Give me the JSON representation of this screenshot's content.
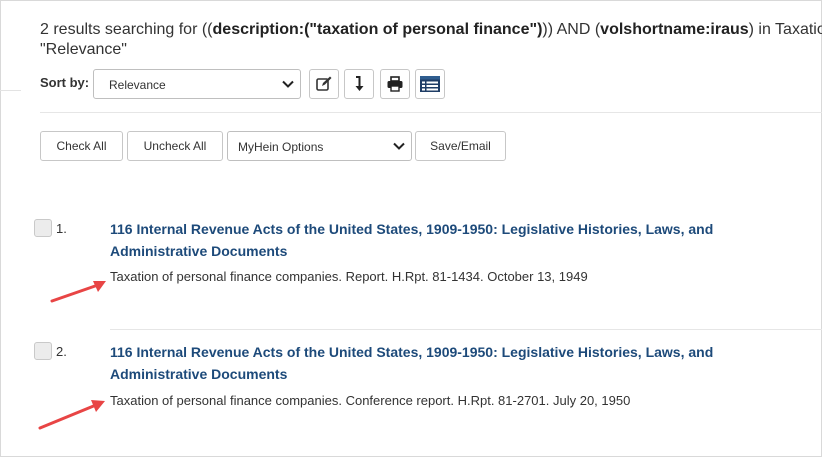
{
  "header": {
    "prefix": "2 results searching for ((",
    "q1": "description:",
    "q2": "(\"taxation of personal finance\")",
    "mid": ")) AND (",
    "q3": "volshortname:iraus",
    "suffix": ") in Taxatio",
    "line2": "\"Relevance\""
  },
  "sort": {
    "label": "Sort by:",
    "selected": "Relevance"
  },
  "toolbar_icons": [
    "edit-icon",
    "download-icon",
    "print-icon",
    "list-view-icon"
  ],
  "actions": {
    "check_all": "Check All",
    "uncheck_all": "Uncheck All",
    "myhein_selected": "MyHein Options",
    "save_email": "Save/Email"
  },
  "results": [
    {
      "number": "1.",
      "title": "116 Internal Revenue Acts of the United States, 1909-1950: Legislative Histories, Laws, and Administrative Documents",
      "description": "Taxation of personal finance companies. Report. H.Rpt. 81-1434. October 13, 1949"
    },
    {
      "number": "2.",
      "title": "116 Internal Revenue Acts of the United States, 1909-1950: Legislative Histories, Laws, and Administrative Documents",
      "description": "Taxation of personal finance companies. Conference report. H.Rpt. 81-2701. July 20, 1950"
    }
  ],
  "colors": {
    "title_link": "#1d4a7a",
    "annotation_arrow": "#e84545"
  }
}
